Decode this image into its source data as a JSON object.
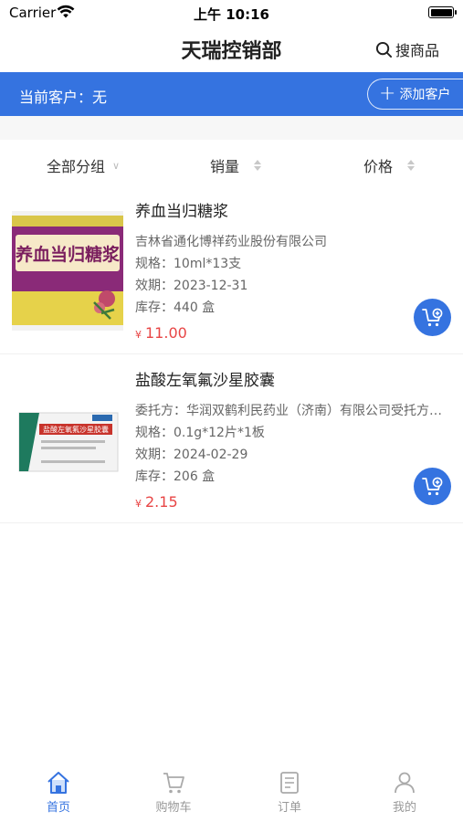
{
  "status_bar": {
    "carrier": "Carrier",
    "time": "上午 10:16"
  },
  "header": {
    "title": "天瑞控销部",
    "search_label": "搜商品"
  },
  "customer_bar": {
    "current_customer": "当前客户：无",
    "add_customer_label": "添加客户"
  },
  "sort_bar": {
    "group_label": "全部分组",
    "sales_label": "销量",
    "price_label": "价格"
  },
  "products": [
    {
      "name": "养血当归糖浆",
      "manufacturer": "吉林省通化博祥药业股份有限公司",
      "spec": "规格：10ml*13支",
      "expiry": "效期：2023-12-31",
      "stock": "库存：440 盒",
      "currency": "¥",
      "price": "11.00",
      "package_text": "养血当归糖浆"
    },
    {
      "name": "盐酸左氧氟沙星胶囊",
      "manufacturer": "委托方：华润双鹤利民药业（济南）有限公司受托方：...",
      "spec": "规格：0.1g*12片*1板",
      "expiry": "效期：2024-02-29",
      "stock": "库存：206 盒",
      "currency": "¥",
      "price": "2.15",
      "package_text": "盐酸左氧氟沙星胶囊"
    }
  ],
  "tab_bar": {
    "items": [
      {
        "label": "首页",
        "icon": "home-icon",
        "active": true
      },
      {
        "label": "购物车",
        "icon": "cart-icon",
        "active": false
      },
      {
        "label": "订单",
        "icon": "order-icon",
        "active": false
      },
      {
        "label": "我的",
        "icon": "profile-icon",
        "active": false
      }
    ]
  },
  "colors": {
    "accent": "#3573e0",
    "price": "#e84545",
    "inactive": "#999999"
  }
}
